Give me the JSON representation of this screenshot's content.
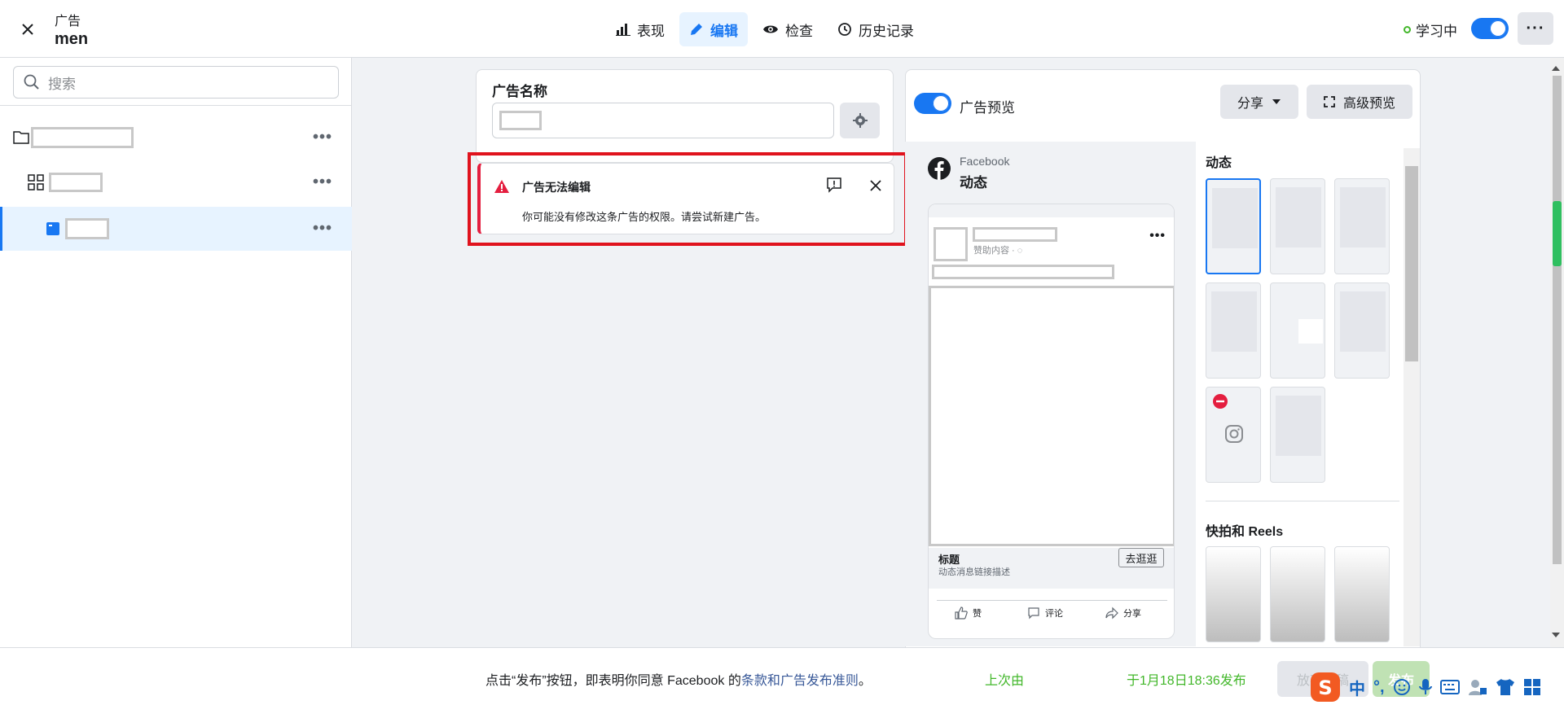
{
  "header": {
    "category": "广告",
    "name": "men",
    "learning_label": "学习中"
  },
  "tabs": [
    {
      "label": "表现",
      "icon": "bar-chart-icon"
    },
    {
      "label": "编辑",
      "icon": "pencil-icon"
    },
    {
      "label": "检查",
      "icon": "eye-icon"
    },
    {
      "label": "历史记录",
      "icon": "history-icon"
    }
  ],
  "sidebar": {
    "search_placeholder": "搜索"
  },
  "editor": {
    "ad_name_label": "广告名称"
  },
  "alert": {
    "title": "广告无法编辑",
    "description": "你可能没有修改这条广告的权限。请尝试新建广告。"
  },
  "preview": {
    "toggle_label": "广告预览",
    "share_label": "分享",
    "advanced_label": "高级预览",
    "fb_brand": "Facebook",
    "fb_placement": "动态",
    "post_sponsored": "赞助内容 · ",
    "post_headline": "标题",
    "post_description": "动态消息链接描述",
    "cta_label": "去逛逛",
    "actions": [
      "赞",
      "评论",
      "分享"
    ],
    "sections": {
      "feeds": "动态",
      "reels": "快拍和 Reels"
    }
  },
  "footer": {
    "agree_prefix": "点击“发布”按钮，即表明你同意 Facebook 的",
    "agree_link": "条款和广告发布准则",
    "agree_suffix": "。",
    "status_prefix": "上次由",
    "status_suffix": "于1月18日18:36发布",
    "discard_label": "放弃草稿",
    "publish_label": "发布"
  },
  "ime": {
    "mode": "中",
    "punct": "°,"
  },
  "colors": {
    "accent": "#1877f2",
    "alert": "#e41e3f",
    "success": "#42b72a"
  }
}
